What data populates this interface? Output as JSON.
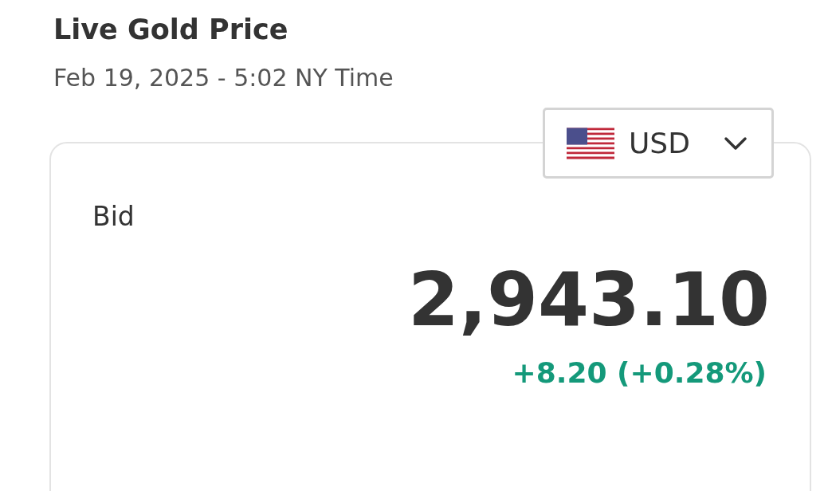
{
  "title": "Live Gold Price",
  "timestamp": "Feb 19, 2025 - 5:02 NY Time",
  "currency_select": {
    "value": "USD"
  },
  "quote": {
    "label": "Bid",
    "price": "2,943.10",
    "change": "+8.20 (+0.28%)",
    "positive": true
  }
}
